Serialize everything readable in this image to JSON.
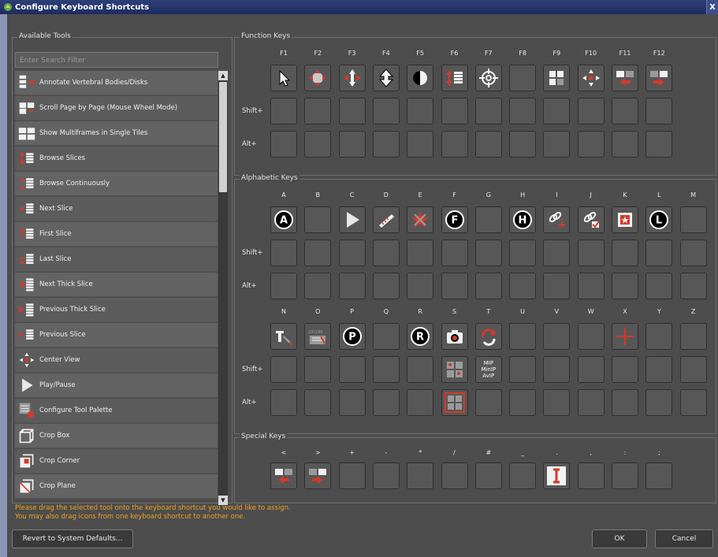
{
  "window": {
    "title": "Configure Keyboard Shortcuts",
    "close_glyph": "X"
  },
  "available": {
    "title": "Available Tools",
    "search_placeholder": "Enter Search Filter",
    "tools": [
      {
        "label": "Annotate Vertebral Bodies/Disks",
        "icon": "vertebrae-annotate-icon"
      },
      {
        "label": "Scroll Page by Page (Mouse Wheel Mode)",
        "icon": "scroll-page-icon"
      },
      {
        "label": "Show Multiframes in Single Tiles",
        "icon": "multiframe-tiles-icon"
      },
      {
        "label": "Browse Slices",
        "icon": "browse-slices-icon"
      },
      {
        "label": "Browse Continuously",
        "icon": "browse-continuously-icon"
      },
      {
        "label": "Next Slice",
        "icon": "next-slice-icon"
      },
      {
        "label": "First Slice",
        "icon": "first-slice-icon"
      },
      {
        "label": "Last Slice",
        "icon": "last-slice-icon"
      },
      {
        "label": "Next Thick Slice",
        "icon": "next-thick-slice-icon"
      },
      {
        "label": "Previous Thick Slice",
        "icon": "previous-thick-slice-icon"
      },
      {
        "label": "Previous Slice",
        "icon": "previous-slice-icon"
      },
      {
        "label": "Center View",
        "icon": "center-view-icon"
      },
      {
        "label": "Play/Pause",
        "icon": "play-icon"
      },
      {
        "label": "Configure Tool Palette",
        "icon": "tool-palette-icon"
      },
      {
        "label": "Crop Box",
        "icon": "crop-box-icon"
      },
      {
        "label": "Crop Corner",
        "icon": "crop-corner-icon"
      },
      {
        "label": "Crop Plane",
        "icon": "crop-plane-icon"
      }
    ]
  },
  "function_keys": {
    "title": "Function Keys",
    "keys": [
      "F1",
      "F2",
      "F3",
      "F4",
      "F5",
      "F6",
      "F7",
      "F8",
      "F9",
      "F10",
      "F11",
      "F12"
    ],
    "row_labels": [
      "",
      "Shift+",
      "Alt+"
    ],
    "assigned": {
      "F1": "pointer-icon",
      "F2": "pan-icon",
      "F3": "move-icon",
      "F4": "zoom-icon",
      "F5": "contrast-icon",
      "F6": "browse-slices-icon",
      "F7": "crosshair-icon",
      "F9": "layout-icon",
      "F10": "center-view-icon",
      "F11": "previous-series-icon",
      "F12": "next-series-icon"
    }
  },
  "alphabetic_keys": {
    "title": "Alphabetic Keys",
    "row1_keys": [
      "A",
      "B",
      "C",
      "D",
      "E",
      "F",
      "G",
      "H",
      "I",
      "J",
      "K",
      "L",
      "M"
    ],
    "row2_keys": [
      "N",
      "O",
      "P",
      "Q",
      "R",
      "S",
      "T",
      "U",
      "V",
      "W",
      "X",
      "Y",
      "Z"
    ],
    "row_labels": [
      "",
      "Shift+",
      "Alt+"
    ],
    "letter_badges": {
      "A": "A",
      "F": "F",
      "H": "H",
      "L": "L",
      "P": "P",
      "R": "R"
    },
    "shift_t_text": "MIP\nMinIP\nAvIP",
    "assigned_icons": {
      "C": "play-icon",
      "D": "measure-ruler-icon",
      "E": "annotation-star-icon",
      "I": "link-icon",
      "J": "link-check-icon",
      "K": "key-image-icon",
      "N": "text-annotation-icon",
      "O": "dicom-icon",
      "S": "snapshot-icon",
      "T": "rotate-icon",
      "X": "cross-reference-icon",
      "Shift+S": "fusion-grid-icon",
      "Alt+S": "fusion-grid-selected-icon"
    },
    "accent_color": "#d23a2a"
  },
  "special_keys": {
    "title": "Special Keys",
    "keys": [
      "<",
      ">",
      "+",
      "-",
      "*",
      "/",
      "#",
      "_",
      ".",
      ",",
      ":",
      ";"
    ],
    "assigned": {
      "<": "previous-series-icon",
      ">": "next-series-icon",
      ".": "text-cursor-icon"
    }
  },
  "footer": {
    "message_line1": "Please drag the selected tool onto the keyboard shortcut you would like to assign.",
    "message_line2": "You may also drag icons from one keyboard shortcut to another one.",
    "message_color": "#f0a020",
    "revert_label": "Revert to System Defaults...",
    "ok_label": "OK",
    "cancel_label": "Cancel"
  }
}
